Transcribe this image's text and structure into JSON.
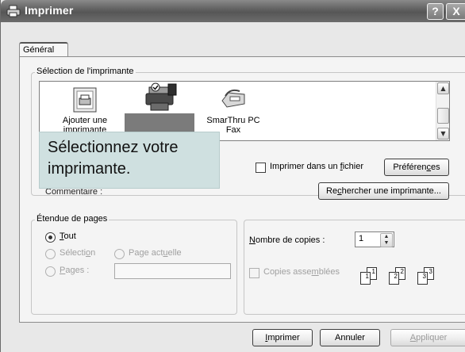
{
  "window": {
    "title": "Imprimer",
    "help_button": "?",
    "close_button": "X"
  },
  "tabs": [
    {
      "label": "Général"
    }
  ],
  "printer_selection": {
    "group_label": "Sélection de l'imprimante",
    "printers": [
      {
        "label_line1": "Ajouter une",
        "label_line2": "imprimante",
        "icon": "add-printer-icon"
      },
      {
        "label_line1": "",
        "label_line2": "",
        "icon": "printer-icon",
        "selected": true
      },
      {
        "label_line1": "SmarThru PC",
        "label_line2": "Fax",
        "icon": "fax-icon"
      }
    ]
  },
  "callout": {
    "line1": "Sélectionnez votre",
    "line2": "imprimante."
  },
  "status": {
    "comment_label": "Commentaire :"
  },
  "print_to_file": {
    "label_prefix": "Imprimer dans un ",
    "label_ul": "f",
    "label_suffix": "ichier",
    "checked": false
  },
  "buttons": {
    "preferences_prefix": "Préféren",
    "preferences_ul": "c",
    "preferences_suffix": "es",
    "find_printer_prefix": "Re",
    "find_printer_ul": "c",
    "find_printer_suffix": "hercher une imprimante...",
    "print_ul": "I",
    "print_rest": "mprimer",
    "cancel": "Annuler",
    "apply_ul": "A",
    "apply_rest": "ppliquer"
  },
  "page_range": {
    "group_label": "Étendue de pages",
    "all_ul": "T",
    "all_rest": "out",
    "selection_prefix": "Sélecti",
    "selection_ul": "o",
    "selection_suffix": "n",
    "current_prefix": "Page act",
    "current_ul": "u",
    "current_suffix": "elle",
    "pages_ul": "P",
    "pages_rest": "ages :",
    "pages_value": "",
    "selected": "all"
  },
  "copies": {
    "label_ul": "N",
    "label_rest": "ombre de copies :",
    "value": "1",
    "collate_prefix": "Copies asse",
    "collate_ul": "m",
    "collate_suffix": "blées",
    "collate_checked": false,
    "page_numbers": [
      "1",
      "1",
      "2",
      "2",
      "3",
      "3"
    ]
  }
}
